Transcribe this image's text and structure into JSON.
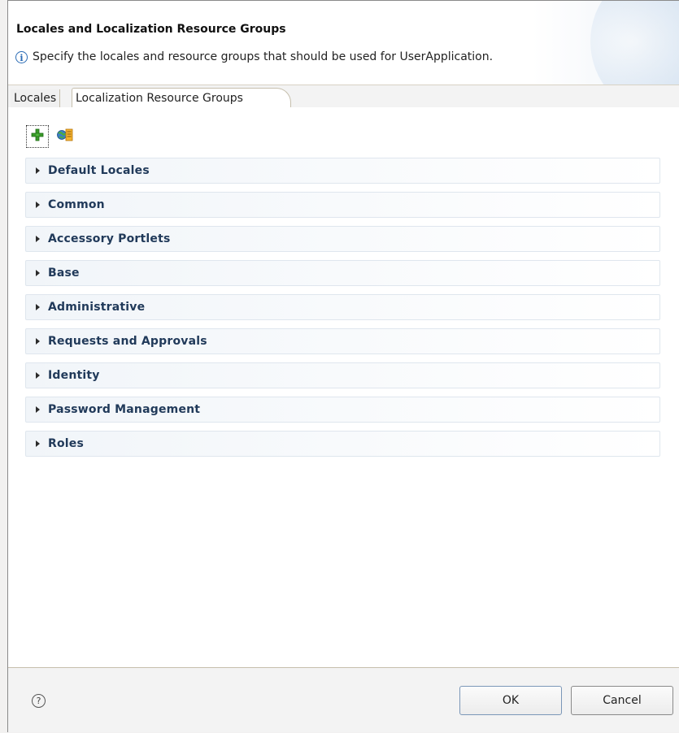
{
  "dialog": {
    "title": "Locales and Localization Resource Groups",
    "message": "Specify the locales and resource groups that should be used for UserApplication."
  },
  "tabs": [
    {
      "label": "Locales",
      "selected": false
    },
    {
      "label": "Localization Resource Groups",
      "selected": true
    }
  ],
  "toolbar": {
    "buttons": [
      {
        "icon": "add-icon",
        "color": "#3a9a2a"
      },
      {
        "icon": "resource-group-icon",
        "color": "#e08a1c"
      }
    ]
  },
  "sections": [
    {
      "label": "Default Locales",
      "expanded": false
    },
    {
      "label": "Common",
      "expanded": false
    },
    {
      "label": "Accessory Portlets",
      "expanded": false
    },
    {
      "label": "Base",
      "expanded": false
    },
    {
      "label": "Administrative",
      "expanded": false
    },
    {
      "label": "Requests and Approvals",
      "expanded": false
    },
    {
      "label": "Identity",
      "expanded": false
    },
    {
      "label": "Password Management",
      "expanded": false
    },
    {
      "label": "Roles",
      "expanded": false
    }
  ],
  "footer": {
    "help_icon": "help-icon",
    "ok_label": "OK",
    "cancel_label": "Cancel"
  },
  "colors": {
    "section_label": "#213a5a",
    "info_blue": "#2a6bb5"
  }
}
